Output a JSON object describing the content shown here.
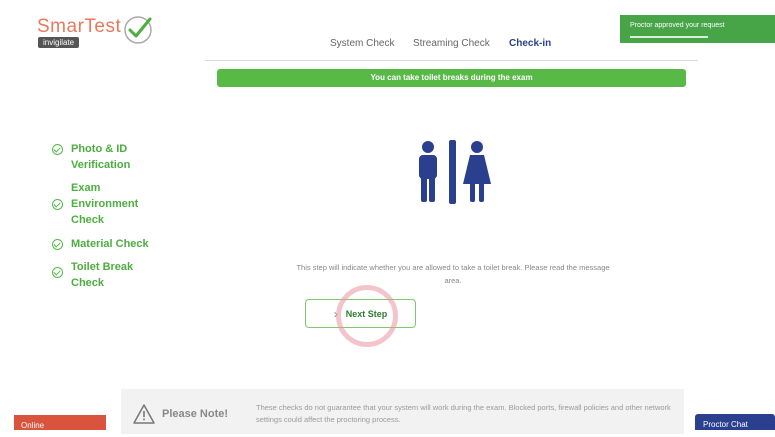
{
  "logo": {
    "name": "SmarTest",
    "badge": "invigilate"
  },
  "tabs": [
    {
      "label": "System Check"
    },
    {
      "label": "Streaming Check"
    },
    {
      "label": "Check-in"
    }
  ],
  "toast": {
    "message": "Proctor approved your request"
  },
  "banner": {
    "text": "You can take toilet breaks during the exam"
  },
  "steps": [
    {
      "label": "Photo & ID Verification"
    },
    {
      "label": "Exam Environment Check"
    },
    {
      "label": "Material Check"
    },
    {
      "label": "Toilet Break Check"
    }
  ],
  "main": {
    "icon": "restroom-icon",
    "description": "This step will indicate whether you are allowed to take a toilet break. Please read the message area.",
    "next_label": "Next Step"
  },
  "note": {
    "title": "Please Note!",
    "text": "These checks do not guarantee that your system will work during the exam. Blocked ports, firewall policies and other network settings could affect the proctoring process."
  },
  "footer": {
    "online_label": "Online",
    "chat_label": "Proctor Chat"
  },
  "colors": {
    "accent_green": "#58b947",
    "brand_blue": "#2b3f8f",
    "online_red": "#d9533d",
    "logo_orange": "#e8795b"
  }
}
